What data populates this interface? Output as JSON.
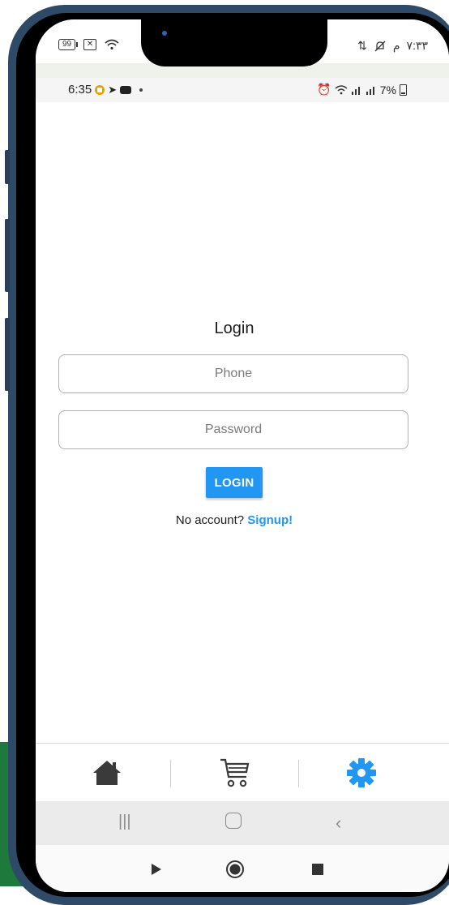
{
  "outer_status": {
    "battery": "99",
    "time": "٧:٣٣",
    "ampm": "م"
  },
  "inner_status": {
    "time": "6:35",
    "battery": "7%"
  },
  "login": {
    "title": "Login",
    "phone_placeholder": "Phone",
    "password_placeholder": "Password",
    "button_label": "LOGIN",
    "no_account_text": "No account?",
    "signup_link": "Signup!"
  },
  "bottom_nav": {
    "items": [
      {
        "icon": "home-icon",
        "active": false
      },
      {
        "icon": "cart-icon",
        "active": false
      },
      {
        "icon": "gear-icon",
        "active": true
      }
    ]
  },
  "colors": {
    "accent": "#2196f3",
    "frame": "#2e4a66"
  }
}
